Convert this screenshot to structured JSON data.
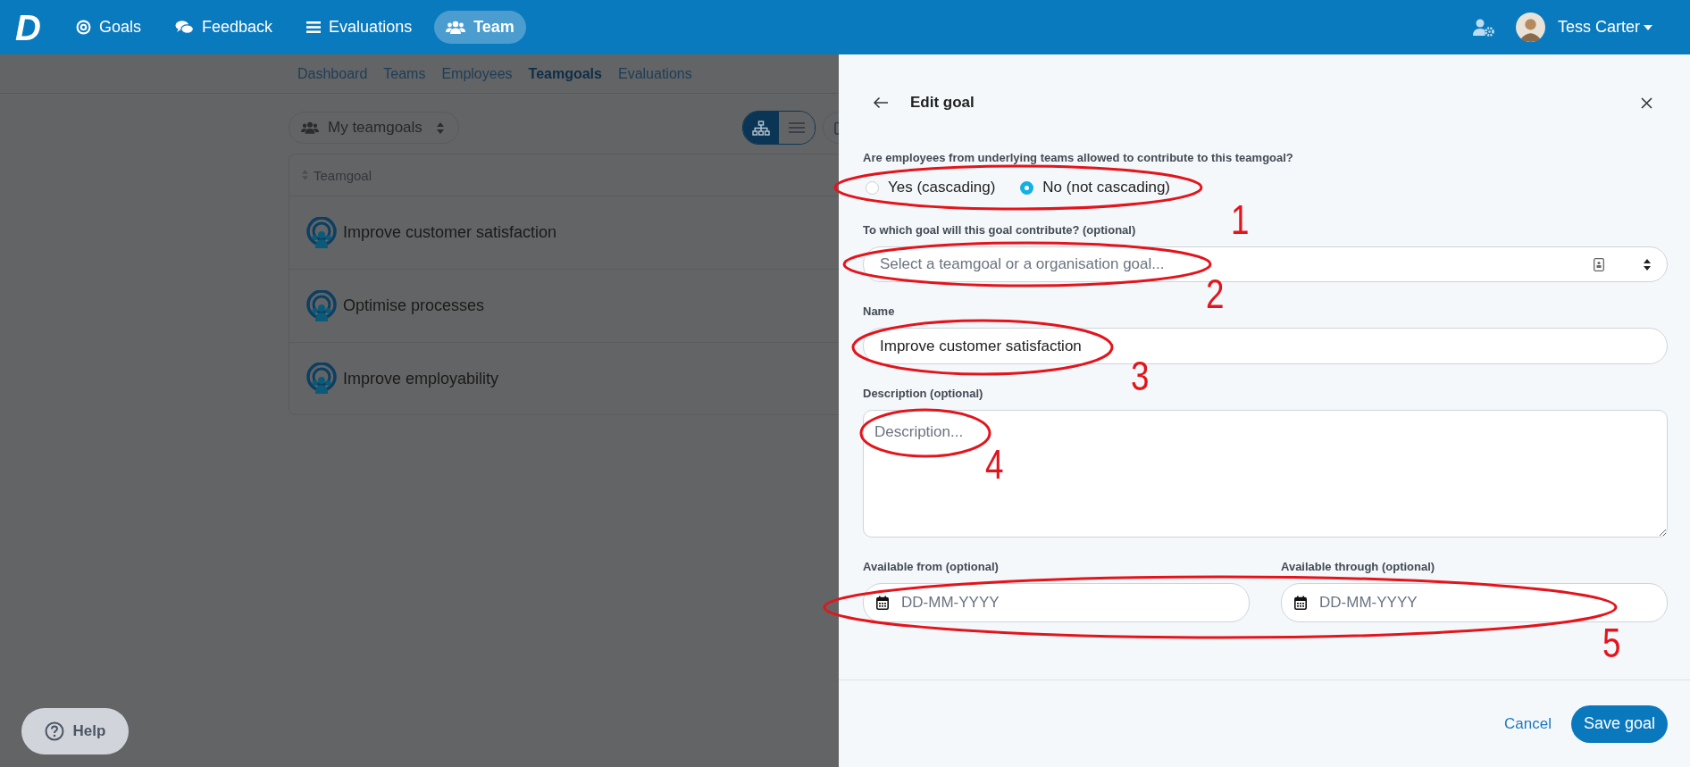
{
  "top_nav": {
    "logo": "D",
    "items": [
      {
        "label": "Goals",
        "selected": false
      },
      {
        "label": "Feedback",
        "selected": false
      },
      {
        "label": "Evaluations",
        "selected": false
      },
      {
        "label": "Team",
        "selected": true
      }
    ],
    "user": {
      "name": "Tess Carter"
    }
  },
  "sub_nav": {
    "items": [
      {
        "label": "Dashboard",
        "selected": false
      },
      {
        "label": "Teams",
        "selected": false
      },
      {
        "label": "Employees",
        "selected": false
      },
      {
        "label": "Teamgoals",
        "selected": true
      },
      {
        "label": "Evaluations",
        "selected": false
      }
    ]
  },
  "toolbar": {
    "filter": {
      "value": "My teamgoals"
    },
    "view_toggle": [
      {
        "kind": "tree",
        "selected": true
      },
      {
        "kind": "list",
        "selected": false
      }
    ]
  },
  "table": {
    "columns": [
      "Teamgoal"
    ],
    "rows": [
      {
        "name": "Improve customer satisfaction"
      },
      {
        "name": "Optimise processes"
      },
      {
        "name": "Improve employability"
      }
    ]
  },
  "help_button": {
    "label": "Help"
  },
  "panel": {
    "title": "Edit goal",
    "fields": [
      {
        "kind": "radio",
        "label": "Are employees from underlying teams allowed to contribute to this teamgoal?",
        "options": [
          {
            "label": "Yes (cascading)",
            "selected": false
          },
          {
            "label": "No (not cascading)",
            "selected": true
          }
        ]
      },
      {
        "kind": "select",
        "label": "To which goal will this goal contribute? (optional)",
        "placeholder": "Select a teamgoal or a organisation goal..."
      },
      {
        "kind": "text",
        "label": "Name",
        "value": "Improve customer satisfaction"
      },
      {
        "kind": "textarea",
        "label": "Description (optional)",
        "placeholder": "Description..."
      },
      {
        "kind": "dates",
        "items": [
          {
            "label": "Available from (optional)",
            "placeholder": "DD-MM-YYYY"
          },
          {
            "label": "Available through (optional)",
            "placeholder": "DD-MM-YYYY"
          }
        ]
      }
    ],
    "buttons": {
      "cancel": "Cancel",
      "save": "Save goal"
    }
  },
  "annotations": [
    {
      "number": "1"
    },
    {
      "number": "2"
    },
    {
      "number": "3"
    },
    {
      "number": "4"
    },
    {
      "number": "5"
    }
  ]
}
